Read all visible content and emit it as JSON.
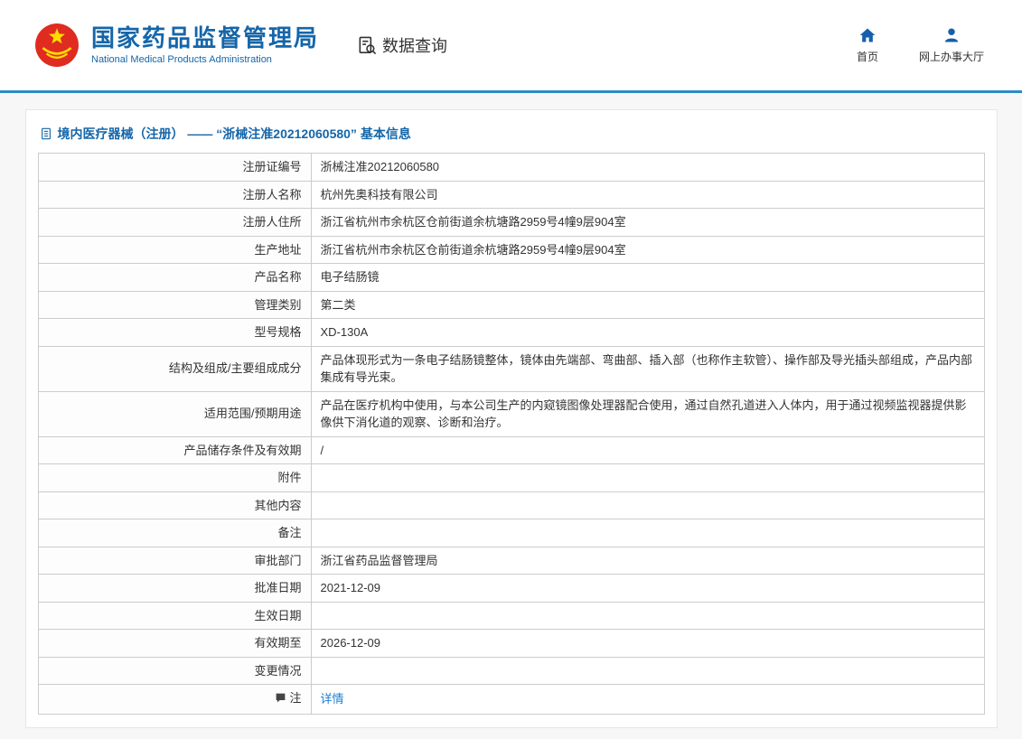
{
  "header": {
    "org_name_zh": "国家药品监督管理局",
    "org_name_en": "National Medical Products Administration",
    "data_query_label": "数据查询",
    "nav_home": "首页",
    "nav_hall": "网上办事大厅"
  },
  "panel": {
    "title": "境内医疗器械（注册） —— “浙械注准20212060580” 基本信息"
  },
  "table": {
    "rows": [
      {
        "label": "注册证编号",
        "value": "浙械注准20212060580"
      },
      {
        "label": "注册人名称",
        "value": "杭州先奥科技有限公司"
      },
      {
        "label": "注册人住所",
        "value": "浙江省杭州市余杭区仓前街道余杭塘路2959号4幢9层904室"
      },
      {
        "label": "生产地址",
        "value": "浙江省杭州市余杭区仓前街道余杭塘路2959号4幢9层904室"
      },
      {
        "label": "产品名称",
        "value": "电子结肠镜"
      },
      {
        "label": "管理类别",
        "value": "第二类"
      },
      {
        "label": "型号规格",
        "value": "XD-130A"
      },
      {
        "label": "结构及组成/主要组成成分",
        "value": "产品体现形式为一条电子结肠镜整体，镜体由先端部、弯曲部、插入部（也称作主软管）、操作部及导光插头部组成，产品内部集成有导光束。"
      },
      {
        "label": "适用范围/预期用途",
        "value": "产品在医疗机构中使用，与本公司生产的内窥镜图像处理器配合使用，通过自然孔道进入人体内，用于通过视频监视器提供影像供下消化道的观察、诊断和治疗。"
      },
      {
        "label": "产品储存条件及有效期",
        "value": "/"
      },
      {
        "label": "附件",
        "value": ""
      },
      {
        "label": "其他内容",
        "value": ""
      },
      {
        "label": "备注",
        "value": ""
      },
      {
        "label": "审批部门",
        "value": "浙江省药品监督管理局"
      },
      {
        "label": "批准日期",
        "value": "2021-12-09"
      },
      {
        "label": "生效日期",
        "value": ""
      },
      {
        "label": "有效期至",
        "value": "2026-12-09"
      },
      {
        "label": "变更情况",
        "value": ""
      },
      {
        "label": "注",
        "value": "详情"
      }
    ]
  },
  "colors": {
    "accent_blue": "#1566a9",
    "header_line_blue": "#2a8dc9",
    "link_blue": "#1b7fd0",
    "logo_red": "#e02b20",
    "logo_gold": "#ffde00",
    "page_bg": "#f7f7f7",
    "table_border": "#cccccc"
  }
}
